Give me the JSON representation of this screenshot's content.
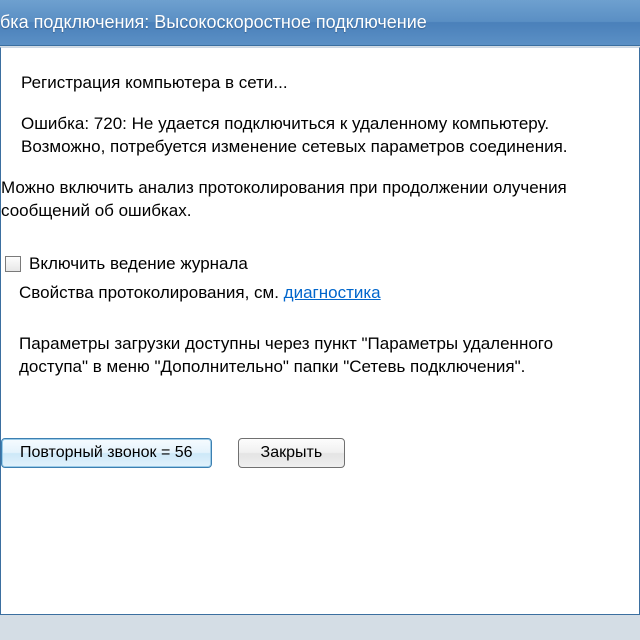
{
  "title": "бка подключения: Высокоскоростное подключение",
  "status_line": "Регистрация компьютера в сети...",
  "error_text": "Ошибка: 720: Не удается подключиться к удаленному компьютеру. Возможно, потребуется изменение сетевых параметров соединения.",
  "analysis_hint": "Можно включить анализ протоколирования при продолжении олучения сообщений об ошибках.",
  "checkbox_label": "Включить ведение журнала",
  "logging_props_prefix": "Свойства протоколирования, см. ",
  "diagnostics_link": "диагностика",
  "params_note": "Параметры загрузки доступны через пункт \"Параметры удаленного доступа\" в меню \"Дополнительно\" папки \"Сетевь подключения\".",
  "buttons": {
    "redial": "Повторный звонок = 56",
    "close": "Закрыть"
  }
}
